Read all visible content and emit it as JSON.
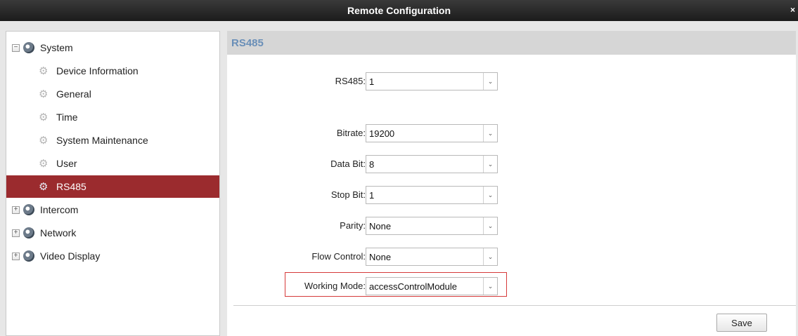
{
  "window": {
    "title": "Remote Configuration",
    "close_label": "×"
  },
  "sidebar": {
    "items": [
      {
        "label": "System",
        "expander": "−"
      },
      {
        "label": "Device Information"
      },
      {
        "label": "General"
      },
      {
        "label": "Time"
      },
      {
        "label": "System Maintenance"
      },
      {
        "label": "User"
      },
      {
        "label": "RS485",
        "selected": true
      },
      {
        "label": "Intercom",
        "expander": "+"
      },
      {
        "label": "Network",
        "expander": "+"
      },
      {
        "label": "Video Display",
        "expander": "+"
      }
    ]
  },
  "main": {
    "section_title": "RS485",
    "fields": [
      {
        "label": "RS485:",
        "value": "1"
      },
      {
        "label": "Bitrate:",
        "value": "19200"
      },
      {
        "label": "Data Bit:",
        "value": "8"
      },
      {
        "label": "Stop Bit:",
        "value": "1"
      },
      {
        "label": "Parity:",
        "value": "None"
      },
      {
        "label": "Flow Control:",
        "value": "None"
      },
      {
        "label": "Working Mode:",
        "value": "accessControlModule"
      }
    ],
    "save_label": "Save"
  },
  "icons": {
    "dropdown": "chevron-down-icon",
    "tree_node": "gear-icon",
    "tree_parent": "system-icon"
  },
  "colors": {
    "title_bar": "#1c1c1c",
    "selected": "#9b2b2e",
    "section_title": "#6a8fb8",
    "highlight": "#d63a3a"
  }
}
